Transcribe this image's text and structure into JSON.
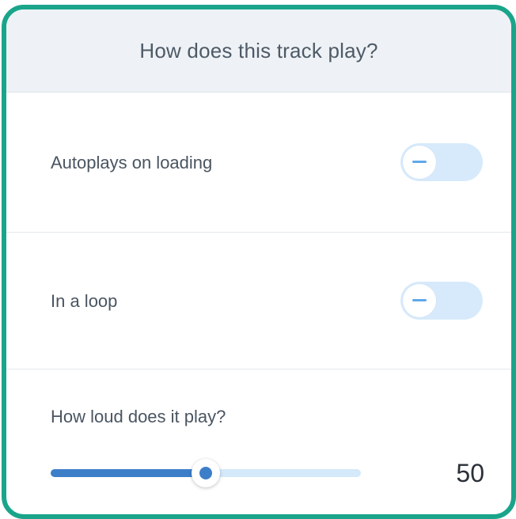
{
  "panel": {
    "title": "How does this track play?"
  },
  "settings": [
    {
      "label": "Autoplays on loading",
      "toggle_on": false
    },
    {
      "label": "In a loop",
      "toggle_on": false
    }
  ],
  "volume": {
    "label": "How loud does it play?",
    "value": "50",
    "fraction": 0.5
  },
  "colors": {
    "frame_border": "#1aa58b",
    "header_bg": "#eef2f6",
    "toggle_off_bg": "#d7eafb",
    "slider_fill": "#3d7ec9",
    "slider_track": "#d4e9fa"
  },
  "icons": {
    "toggle_off": "minus-icon"
  }
}
